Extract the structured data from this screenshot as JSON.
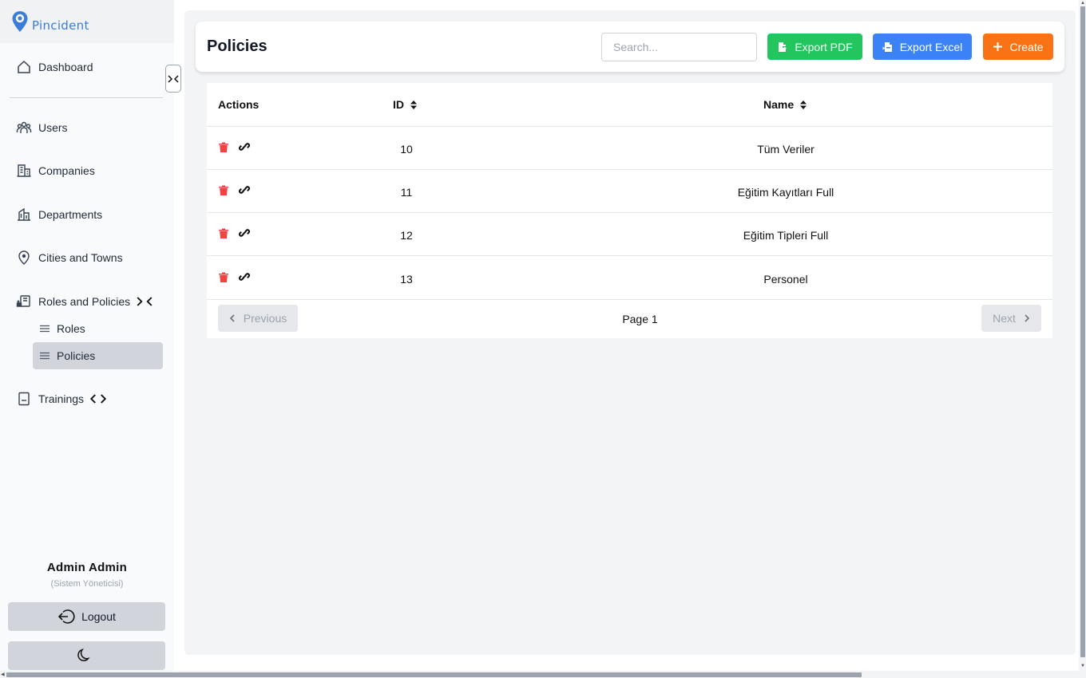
{
  "brand": {
    "name": "Pincident"
  },
  "sidebar": {
    "items": [
      {
        "label": "Dashboard",
        "icon": "home-icon"
      },
      {
        "label": "Users",
        "icon": "users-icon"
      },
      {
        "label": "Companies",
        "icon": "building-icon"
      },
      {
        "label": "Departments",
        "icon": "department-icon"
      },
      {
        "label": "Cities and Towns",
        "icon": "location-pin-icon"
      },
      {
        "label": "Roles and Policies",
        "icon": "roles-icon",
        "expanded": true,
        "children": [
          {
            "label": "Roles"
          },
          {
            "label": "Policies",
            "active": true
          }
        ]
      },
      {
        "label": "Trainings",
        "icon": "book-icon",
        "expanded": false
      }
    ],
    "user": {
      "name": "Admin Admin",
      "role": "(Sistem Yöneticisi)"
    },
    "logout_label": "Logout"
  },
  "header": {
    "title": "Policies",
    "search_placeholder": "Search...",
    "export_pdf_label": "Export PDF",
    "export_excel_label": "Export Excel",
    "create_label": "Create"
  },
  "colors": {
    "green": "#22c55e",
    "blue": "#3b82f6",
    "orange": "#f97316",
    "delete": "#ef4444",
    "brand": "#3b7dd8"
  },
  "table": {
    "columns": {
      "actions": "Actions",
      "id": "ID",
      "name": "Name"
    },
    "rows": [
      {
        "id": "10",
        "name": "Tüm Veriler"
      },
      {
        "id": "11",
        "name": "Eğitim Kayıtları Full"
      },
      {
        "id": "12",
        "name": "Eğitim Tipleri Full"
      },
      {
        "id": "13",
        "name": "Personel"
      }
    ]
  },
  "pagination": {
    "previous_label": "Previous",
    "page_label": "Page 1",
    "next_label": "Next"
  }
}
